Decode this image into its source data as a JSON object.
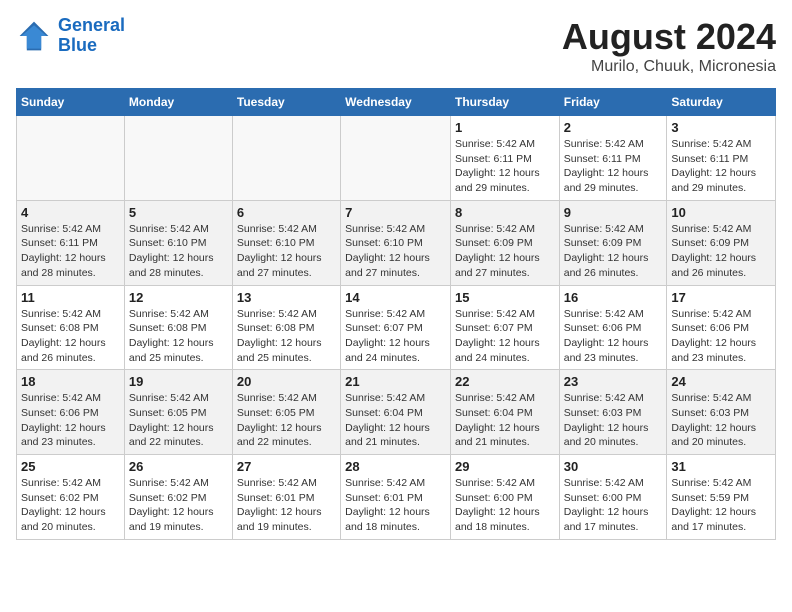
{
  "logo": {
    "line1": "General",
    "line2": "Blue"
  },
  "title": "August 2024",
  "subtitle": "Murilo, Chuuk, Micronesia",
  "days_of_week": [
    "Sunday",
    "Monday",
    "Tuesday",
    "Wednesday",
    "Thursday",
    "Friday",
    "Saturday"
  ],
  "weeks": [
    [
      {
        "day": "",
        "info": ""
      },
      {
        "day": "",
        "info": ""
      },
      {
        "day": "",
        "info": ""
      },
      {
        "day": "",
        "info": ""
      },
      {
        "day": "1",
        "info": "Sunrise: 5:42 AM\nSunset: 6:11 PM\nDaylight: 12 hours\nand 29 minutes."
      },
      {
        "day": "2",
        "info": "Sunrise: 5:42 AM\nSunset: 6:11 PM\nDaylight: 12 hours\nand 29 minutes."
      },
      {
        "day": "3",
        "info": "Sunrise: 5:42 AM\nSunset: 6:11 PM\nDaylight: 12 hours\nand 29 minutes."
      }
    ],
    [
      {
        "day": "4",
        "info": "Sunrise: 5:42 AM\nSunset: 6:11 PM\nDaylight: 12 hours\nand 28 minutes."
      },
      {
        "day": "5",
        "info": "Sunrise: 5:42 AM\nSunset: 6:10 PM\nDaylight: 12 hours\nand 28 minutes."
      },
      {
        "day": "6",
        "info": "Sunrise: 5:42 AM\nSunset: 6:10 PM\nDaylight: 12 hours\nand 27 minutes."
      },
      {
        "day": "7",
        "info": "Sunrise: 5:42 AM\nSunset: 6:10 PM\nDaylight: 12 hours\nand 27 minutes."
      },
      {
        "day": "8",
        "info": "Sunrise: 5:42 AM\nSunset: 6:09 PM\nDaylight: 12 hours\nand 27 minutes."
      },
      {
        "day": "9",
        "info": "Sunrise: 5:42 AM\nSunset: 6:09 PM\nDaylight: 12 hours\nand 26 minutes."
      },
      {
        "day": "10",
        "info": "Sunrise: 5:42 AM\nSunset: 6:09 PM\nDaylight: 12 hours\nand 26 minutes."
      }
    ],
    [
      {
        "day": "11",
        "info": "Sunrise: 5:42 AM\nSunset: 6:08 PM\nDaylight: 12 hours\nand 26 minutes."
      },
      {
        "day": "12",
        "info": "Sunrise: 5:42 AM\nSunset: 6:08 PM\nDaylight: 12 hours\nand 25 minutes."
      },
      {
        "day": "13",
        "info": "Sunrise: 5:42 AM\nSunset: 6:08 PM\nDaylight: 12 hours\nand 25 minutes."
      },
      {
        "day": "14",
        "info": "Sunrise: 5:42 AM\nSunset: 6:07 PM\nDaylight: 12 hours\nand 24 minutes."
      },
      {
        "day": "15",
        "info": "Sunrise: 5:42 AM\nSunset: 6:07 PM\nDaylight: 12 hours\nand 24 minutes."
      },
      {
        "day": "16",
        "info": "Sunrise: 5:42 AM\nSunset: 6:06 PM\nDaylight: 12 hours\nand 23 minutes."
      },
      {
        "day": "17",
        "info": "Sunrise: 5:42 AM\nSunset: 6:06 PM\nDaylight: 12 hours\nand 23 minutes."
      }
    ],
    [
      {
        "day": "18",
        "info": "Sunrise: 5:42 AM\nSunset: 6:06 PM\nDaylight: 12 hours\nand 23 minutes."
      },
      {
        "day": "19",
        "info": "Sunrise: 5:42 AM\nSunset: 6:05 PM\nDaylight: 12 hours\nand 22 minutes."
      },
      {
        "day": "20",
        "info": "Sunrise: 5:42 AM\nSunset: 6:05 PM\nDaylight: 12 hours\nand 22 minutes."
      },
      {
        "day": "21",
        "info": "Sunrise: 5:42 AM\nSunset: 6:04 PM\nDaylight: 12 hours\nand 21 minutes."
      },
      {
        "day": "22",
        "info": "Sunrise: 5:42 AM\nSunset: 6:04 PM\nDaylight: 12 hours\nand 21 minutes."
      },
      {
        "day": "23",
        "info": "Sunrise: 5:42 AM\nSunset: 6:03 PM\nDaylight: 12 hours\nand 20 minutes."
      },
      {
        "day": "24",
        "info": "Sunrise: 5:42 AM\nSunset: 6:03 PM\nDaylight: 12 hours\nand 20 minutes."
      }
    ],
    [
      {
        "day": "25",
        "info": "Sunrise: 5:42 AM\nSunset: 6:02 PM\nDaylight: 12 hours\nand 20 minutes."
      },
      {
        "day": "26",
        "info": "Sunrise: 5:42 AM\nSunset: 6:02 PM\nDaylight: 12 hours\nand 19 minutes."
      },
      {
        "day": "27",
        "info": "Sunrise: 5:42 AM\nSunset: 6:01 PM\nDaylight: 12 hours\nand 19 minutes."
      },
      {
        "day": "28",
        "info": "Sunrise: 5:42 AM\nSunset: 6:01 PM\nDaylight: 12 hours\nand 18 minutes."
      },
      {
        "day": "29",
        "info": "Sunrise: 5:42 AM\nSunset: 6:00 PM\nDaylight: 12 hours\nand 18 minutes."
      },
      {
        "day": "30",
        "info": "Sunrise: 5:42 AM\nSunset: 6:00 PM\nDaylight: 12 hours\nand 17 minutes."
      },
      {
        "day": "31",
        "info": "Sunrise: 5:42 AM\nSunset: 5:59 PM\nDaylight: 12 hours\nand 17 minutes."
      }
    ]
  ]
}
